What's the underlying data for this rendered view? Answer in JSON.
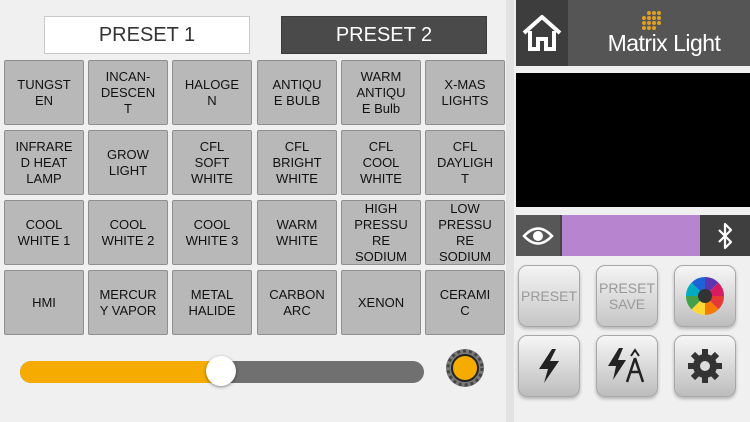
{
  "tabs": {
    "preset1": "PRESET 1",
    "preset2": "PRESET 2"
  },
  "grid": [
    [
      "TUNGST\nEN",
      "INCAN-\nDESCEN\nT",
      "HALOGE\nN",
      "ANTIQU\nE BULB",
      "WARM\nANTIQU\nE Bulb",
      "X-MAS\nLIGHTS"
    ],
    [
      "INFRARE\nD HEAT\nLAMP",
      "GROW\nLIGHT",
      "CFL\nSOFT\nWHITE",
      "CFL\nBRIGHT\nWHITE",
      "CFL\nCOOL\nWHITE",
      "CFL\nDAYLIGH\nT"
    ],
    [
      "COOL\nWHITE 1",
      "COOL\nWHITE 2",
      "COOL\nWHITE 3",
      "WARM\nWHITE",
      "HIGH\nPRESSU\nRE\nSODIUM",
      "LOW\nPRESSU\nRE\nSODIUM"
    ],
    [
      "HMI",
      "MERCUR\nY VAPOR",
      "METAL\nHALIDE",
      "CARBON\nARC",
      "XENON",
      "CERAMI\nC"
    ]
  ],
  "brand": {
    "name": "Matrix Light"
  },
  "slider": {
    "value": 0.5
  },
  "colors": {
    "accent": "#f5ab00",
    "swatch": "#b784d0"
  },
  "buttons": {
    "preset": "PRESET",
    "preset_save": "PRESET\nSAVE"
  },
  "icons": {
    "home": "home-icon",
    "eye": "eye-icon",
    "bluetooth": "bluetooth-icon",
    "color_wheel": "color-wheel-icon",
    "flash": "flash-icon",
    "flash_tools": "flash-tools-icon",
    "settings": "gear-icon"
  }
}
